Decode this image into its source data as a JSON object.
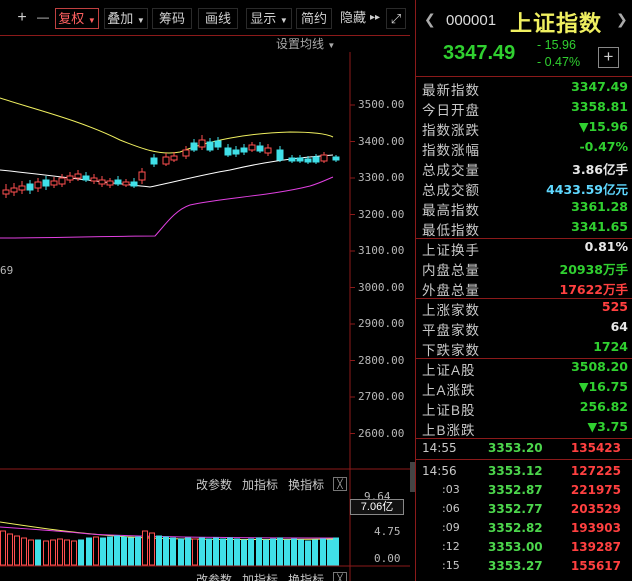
{
  "toolbar": {
    "buttons": [
      "复权",
      "叠加",
      "筹码",
      "画线",
      "显示",
      "简约",
      "隐藏"
    ],
    "plus": "+",
    "minus": "—",
    "more": "▸▸",
    "expand": "⤢"
  },
  "chart": {
    "settings_ma": "设置均线",
    "y_labels": [
      "3500.00",
      "3400.00",
      "3300.00",
      "3200.00",
      "3100.00",
      "3000.00",
      "2900.00",
      "2800.00",
      "2700.00",
      "2600.00"
    ],
    "stray_label": "69",
    "ind1": {
      "change": "改参数",
      "add": "加指标",
      "swap": "换指标",
      "close": "╳"
    },
    "ind2": {
      "change": "改参数",
      "add": "加指标",
      "swap": "换指标",
      "close": "╳"
    },
    "vol_axis": [
      "9.64",
      "7.06亿",
      "4.75",
      "0.00"
    ],
    "colors": {
      "up": "#ff5050",
      "down": "#40e0e8",
      "ma1": "#f0f060",
      "ma2": "#ffffff",
      "ma3": "#e040e0"
    }
  },
  "panel": {
    "code": "000001",
    "name": "上证指数",
    "price": "3347.49",
    "change": "- 15.96",
    "change_pct": "- 0.47%",
    "add": "+",
    "stats1": [
      {
        "label": "最新指数",
        "value": "3347.49",
        "color": "green"
      },
      {
        "label": "今日开盘",
        "value": "3358.81",
        "color": "green"
      },
      {
        "label": "指数涨跌",
        "value": "▼15.96",
        "color": "green"
      },
      {
        "label": "指数涨幅",
        "value": "-0.47%",
        "color": "green"
      },
      {
        "label": "总成交量",
        "value": "3.86亿手",
        "color": "white"
      },
      {
        "label": "总成交额",
        "value": "4433.59亿元",
        "color": "cyan"
      },
      {
        "label": "最高指数",
        "value": "3361.28",
        "color": "green"
      },
      {
        "label": "最低指数",
        "value": "3341.65",
        "color": "green"
      }
    ],
    "stats2": [
      {
        "label": "上证换手",
        "value": "0.81%",
        "color": "white"
      },
      {
        "label": "内盘总量",
        "value": "20938万手",
        "color": "green"
      },
      {
        "label": "外盘总量",
        "value": "17622万手",
        "color": "red"
      }
    ],
    "stats3": [
      {
        "label": "上涨家数",
        "value": "525",
        "color": "red"
      },
      {
        "label": "平盘家数",
        "value": "64",
        "color": "white"
      },
      {
        "label": "下跌家数",
        "value": "1724",
        "color": "green"
      }
    ],
    "stats4": [
      {
        "label": "上证A股",
        "value": "3508.20",
        "color": "green"
      },
      {
        "label": "上A涨跌",
        "value": "▼16.75",
        "color": "green"
      },
      {
        "label": "上证B股",
        "value": "256.82",
        "color": "green"
      },
      {
        "label": "上B涨跌",
        "value": "▼3.75",
        "color": "green"
      }
    ],
    "ticks": [
      {
        "time": "14:55",
        "price": "3353.20",
        "vol": "135423"
      },
      {
        "time": "14:56",
        "price": "3353.12",
        "vol": "127225"
      },
      {
        "time": ":03",
        "price": "3352.87",
        "vol": "221975"
      },
      {
        "time": ":06",
        "price": "3352.77",
        "vol": "203529"
      },
      {
        "time": ":09",
        "price": "3352.82",
        "vol": "193903"
      },
      {
        "time": ":12",
        "price": "3353.00",
        "vol": "139287"
      },
      {
        "time": ":15",
        "price": "3353.27",
        "vol": "155617"
      }
    ]
  }
}
